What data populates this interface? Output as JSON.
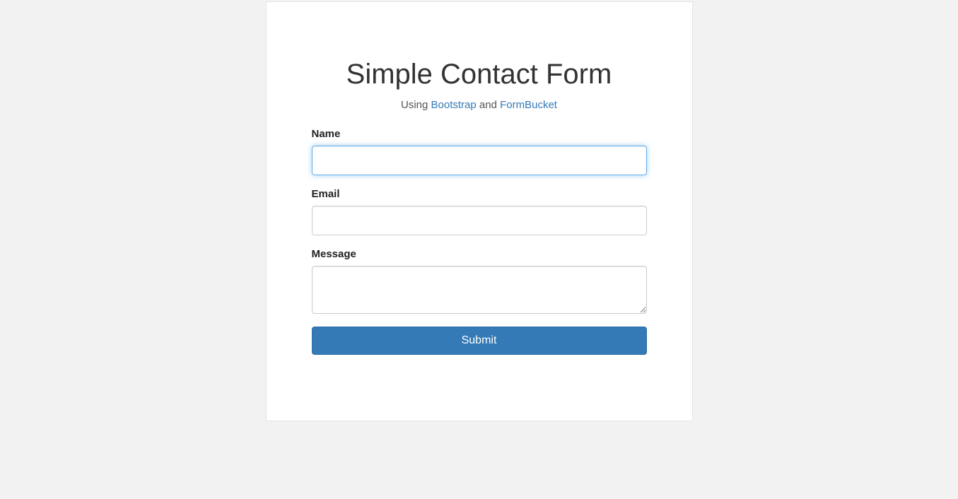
{
  "header": {
    "title": "Simple Contact Form",
    "subtitle_prefix": "Using ",
    "link1_text": "Bootstrap",
    "subtitle_middle": " and ",
    "link2_text": "FormBucket"
  },
  "form": {
    "name_label": "Name",
    "name_value": "",
    "email_label": "Email",
    "email_value": "",
    "message_label": "Message",
    "message_value": "",
    "submit_label": "Submit"
  }
}
